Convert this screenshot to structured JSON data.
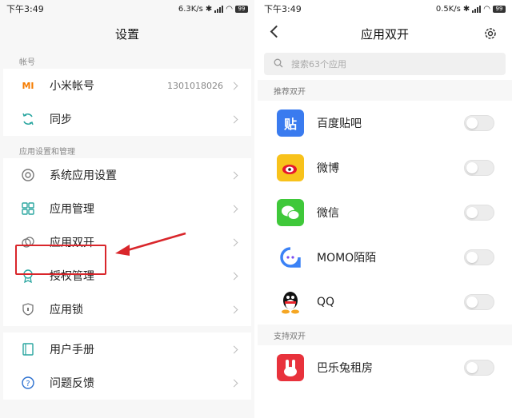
{
  "left": {
    "status": {
      "time": "下午3:49",
      "speed": "6.3K/s",
      "battery": "99"
    },
    "title": "设置",
    "section_account": "帐号",
    "account_items": [
      {
        "label": "小米帐号",
        "value": "1301018026",
        "icon": "mi-logo-icon"
      },
      {
        "label": "同步",
        "value": "",
        "icon": "sync-icon"
      }
    ],
    "section_apps": "应用设置和管理",
    "app_items": [
      {
        "label": "系统应用设置",
        "icon": "gear-ring-icon"
      },
      {
        "label": "应用管理",
        "icon": "grid-icon"
      },
      {
        "label": "应用双开",
        "icon": "dual-app-icon"
      },
      {
        "label": "授权管理",
        "icon": "award-icon"
      },
      {
        "label": "应用锁",
        "icon": "shield-lock-icon"
      }
    ],
    "help_items": [
      {
        "label": "用户手册",
        "icon": "manual-icon"
      },
      {
        "label": "问题反馈",
        "icon": "question-icon"
      }
    ]
  },
  "right": {
    "status": {
      "time": "下午3:49",
      "speed": "0.5K/s",
      "battery": "99"
    },
    "title": "应用双开",
    "search_placeholder": "搜索63个应用",
    "section_recommended": "推荐双开",
    "recommended": [
      {
        "name": "百度贴吧",
        "icon": "tieba-icon",
        "glyph": "贴",
        "color": "#3a7bef"
      },
      {
        "name": "微博",
        "icon": "weibo-icon",
        "glyph": "",
        "color": "#f8c21b"
      },
      {
        "name": "微信",
        "icon": "wechat-icon",
        "glyph": "",
        "color": "#3fc83a"
      },
      {
        "name": "MOMO陌陌",
        "icon": "momo-icon",
        "glyph": "",
        "color": "#ffffff"
      },
      {
        "name": "QQ",
        "icon": "qq-icon",
        "glyph": "",
        "color": "#ffffff"
      }
    ],
    "section_supported": "支持双开",
    "supported": [
      {
        "name": "巴乐兔租房",
        "icon": "baletu-icon",
        "glyph": "",
        "color": "#e8323c"
      }
    ]
  },
  "colors": {
    "highlight": "#d9262b",
    "accent_orange": "#f0a020"
  }
}
